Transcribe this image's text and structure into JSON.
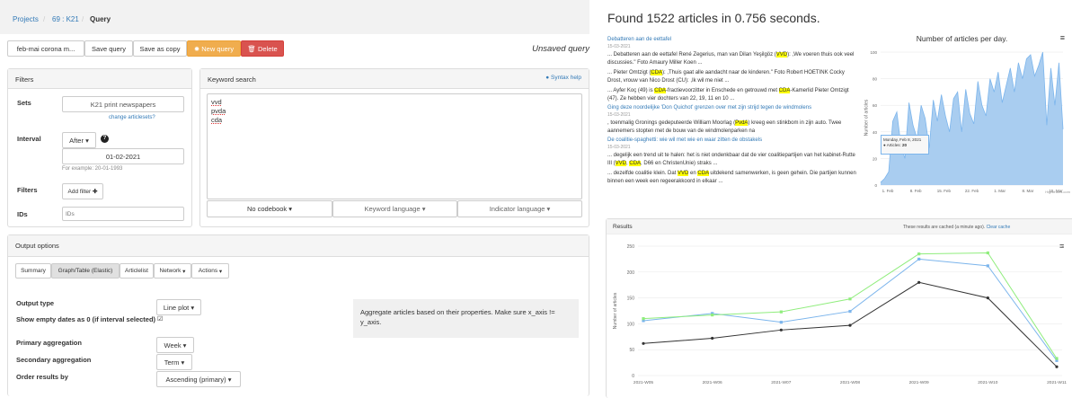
{
  "breadcrumb": {
    "projects": "Projects",
    "project": "69 : K21",
    "current": "Query",
    "sep": "/"
  },
  "toolbar": {
    "query_name": "feb-mai corona m...",
    "save_query": "Save query",
    "save_as_copy": "Save as copy",
    "new_query": "New query",
    "delete": "Delete",
    "status": "Unsaved query"
  },
  "filters": {
    "title": "Filters",
    "sets_label": "Sets",
    "sets_value": "K21 print newspapers",
    "change_sets": "change articlesets?",
    "interval_label": "Interval",
    "interval_mode": "After",
    "interval_date": "01-02-2021",
    "interval_example": "For example: 20-01-1993",
    "filters_label": "Filters",
    "add_filter": "Add filter",
    "ids_label": "IDs",
    "ids_placeholder": "IDs"
  },
  "keyword": {
    "title": "Keyword search",
    "syntax_help": "Syntax help",
    "lines": [
      "vvd",
      "pvda",
      "cda"
    ],
    "codebook": "No codebook",
    "keyword_language": "Keyword language",
    "indicator_language": "Indicator language"
  },
  "output": {
    "title": "Output options",
    "tabs": [
      "Summary",
      "Graph/Table (Elastic)",
      "Articlelist",
      "Network",
      "Actions"
    ],
    "output_type_label": "Output type",
    "output_type": "Line plot",
    "show_empty_label": "Show empty dates as 0 (if interval selected)",
    "primary_label": "Primary aggregation",
    "primary": "Week",
    "secondary_label": "Secondary aggregation",
    "secondary": "Term",
    "order_label": "Order results by",
    "order": "Ascending (primary)",
    "info": "Aggregate articles based on their properties. Make sure x_axis != y_axis."
  },
  "results_heading": "Found 1522 articles in 0.756 seconds.",
  "articles": [
    {
      "title": "Debatteren aan de eettafel",
      "date": "15-03-2021",
      "snippets": [
        "... Debatteren aan de eettafel René Zegerius, man van Dilan Yeşilgöz (VVD): ,We voeren thuis ook veel discussies.\" Foto Amaury Miller Koen ...",
        "... Pieter Omtzigt (CDA): ,Thuis gaat alle aandacht naar de kinderen.\" Foto Robert HOETINK Cocky Drost, vrouw van Nico Drost (CU): ,Ik wil me niet ...",
        "... Ayfer Koç (49) is CDA-fractievoorzitter in Enschede en getrouwd met CDA-Kamerlid Pieter Omtzigt (47). Ze hebben vier dochters van 22, 19, 11 en 10 ..."
      ]
    },
    {
      "title": "Ging deze noordelijke 'Don Quichot' grenzen over met zijn strijd tegen de windmolens",
      "date": "15-03-2021",
      "snippets": [
        ", toenmalig Gronings gedeputeerde William Moorlag (PvdA) kreeg een stinkbom in zijn auto. Twee aannemers stopten met de bouw van de windmolenparken na"
      ]
    },
    {
      "title": "De coalitie-spaghetti: wie wil met wie en waar zitten de obstakels",
      "date": "15-03-2021",
      "snippets": [
        "... degelijk een trend uit te halen: het is niet ondenkbaar dat de vier coalitiepartijen van het kabinet-Rutte III (VVD, CDA, D66 en ChristenUnie) straks ...",
        "... dezelfde coalitie klein. Dat VVD en CDA uitdekend samenwerken, is geen gehein. Die partijen kunnen binnen een week een regeerakkoord in elkaar ..."
      ]
    }
  ],
  "per_day_chart": {
    "title": "Number of articles per day.",
    "ylabel": "Number of articles",
    "yticks": [
      "100",
      "80",
      "60",
      "40",
      "20",
      "0"
    ],
    "xticks": [
      "1. Feb",
      "8. Feb",
      "15. Feb",
      "22. Feb",
      "1. Mar",
      "8. Mar",
      "15. Mar"
    ],
    "tooltip_date": "Monday, Feb 8, 2021",
    "tooltip_label": "Articles:",
    "tooltip_value": "20",
    "credit": "Highcharts.com",
    "menu_icon": "hamburger-icon"
  },
  "results_panel": {
    "title": "Results",
    "cache_text": "These results are cached (a minute ago).",
    "clear_cache": "Clear cache"
  },
  "chart_data": {
    "type": "line",
    "ylabel": "Number of articles",
    "categories": [
      "2021-W05",
      "2021-W06",
      "2021-W07",
      "2021-W08",
      "2021-W09",
      "2021-W10",
      "2021-W11"
    ],
    "ylim": [
      0,
      250
    ],
    "yticks": [
      0,
      50,
      100,
      150,
      200,
      250
    ],
    "series": [
      {
        "values": [
          62,
          72,
          88,
          97,
          180,
          150,
          17
        ],
        "color": "#333333"
      },
      {
        "values": [
          106,
          120,
          103,
          124,
          225,
          212,
          29
        ],
        "color": "#7cb5ec"
      },
      {
        "values": [
          110,
          117,
          123,
          148,
          235,
          237,
          33
        ],
        "color": "#90ed7d"
      }
    ]
  },
  "per_day_data": [
    2,
    5,
    10,
    48,
    55,
    30,
    20,
    62,
    45,
    35,
    60,
    50,
    28,
    64,
    48,
    68,
    52,
    40,
    65,
    70,
    40,
    72,
    54,
    46,
    78,
    60,
    52,
    80,
    70,
    85,
    62,
    75,
    88,
    70,
    92,
    80,
    95,
    98,
    82,
    90,
    100,
    45,
    88,
    60,
    92,
    42
  ]
}
